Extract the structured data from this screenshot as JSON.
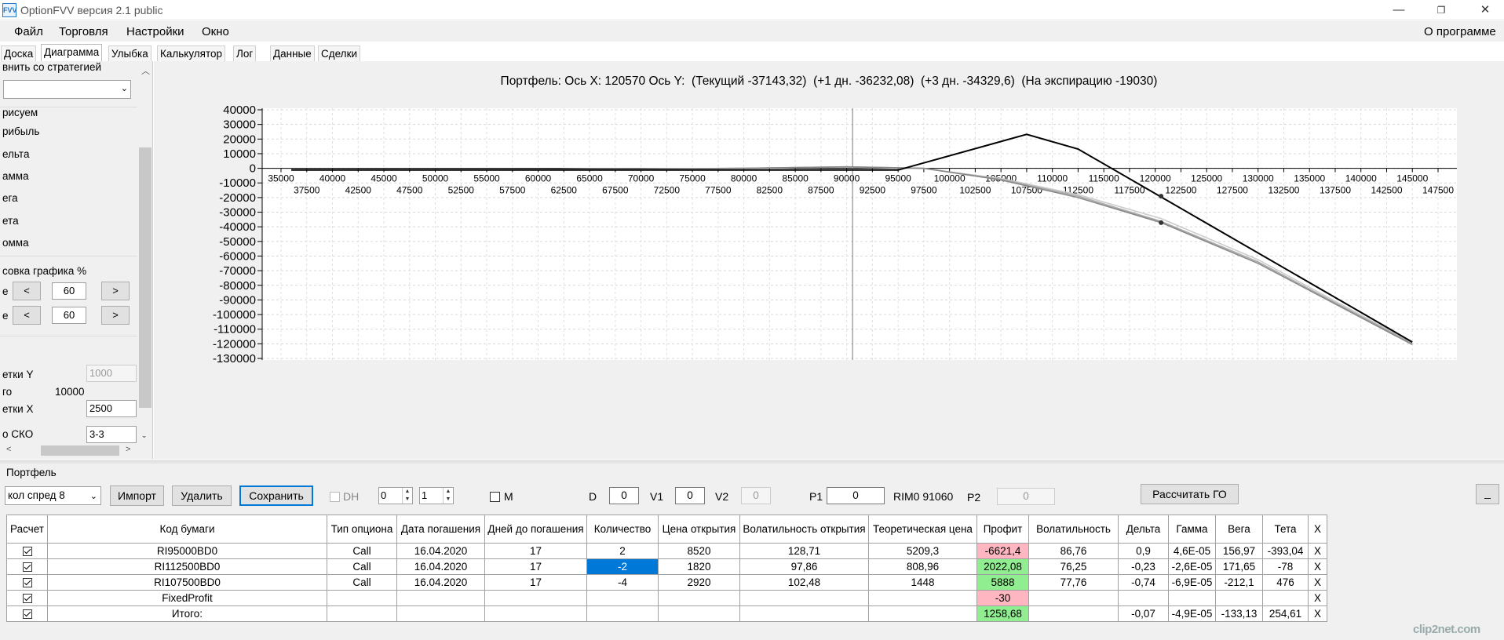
{
  "window": {
    "title": "OptionFVV версия 2.1 public",
    "icon_text": "FVV",
    "minimize": "—",
    "restore": "❐",
    "close": "✕"
  },
  "menu": {
    "file": "Файл",
    "trading": "Торговля",
    "settings": "Настройки",
    "window": "Окно",
    "about": "О программе"
  },
  "tabs": [
    "Доска",
    "Диаграмма",
    "Улыбка",
    "Калькулятор",
    "Лог",
    "Данные",
    "Сделки"
  ],
  "left_panel": {
    "compare_label": "внить со стратегией",
    "draw_label": "рисуем",
    "items": [
      "рибыль",
      "ельта",
      "амма",
      "ега",
      "ета",
      "омма"
    ],
    "scale_label": "совка графика %",
    "row1_prefix": "е",
    "row2_prefix": "е",
    "left_btn": "<",
    "right_btn": ">",
    "scale1_value": "60",
    "scale2_value": "60",
    "grid_y_label": "етки Y",
    "grid_y_value": "1000",
    "total_label": "го",
    "total_value": "10000",
    "grid_x_label": "етки X",
    "grid_x_value": "2500",
    "sko_label": "о СКО",
    "sko_value": "3-3"
  },
  "chart_data": {
    "type": "line",
    "title": "Портфель: Ось X: 120570 Ось Y:  (Текущий -37143,32)  (+1 дн. -36232,08)  (+3 дн. -34329,6)  (На экспирацию -19030)",
    "xlim": [
      35000,
      147500
    ],
    "ylim": [
      -130000,
      40000
    ],
    "y_ticks": [
      40000,
      30000,
      20000,
      10000,
      0,
      -10000,
      -20000,
      -30000,
      -40000,
      -50000,
      -60000,
      -70000,
      -80000,
      -90000,
      -100000,
      -110000,
      -120000,
      -130000
    ],
    "x_ticks_upper": [
      35000,
      40000,
      45000,
      50000,
      55000,
      60000,
      65000,
      70000,
      75000,
      80000,
      85000,
      90000,
      95000,
      100000,
      105000,
      110000,
      115000,
      120000,
      125000,
      130000,
      135000,
      140000,
      145000
    ],
    "x_ticks_lower": [
      37500,
      42500,
      47500,
      52500,
      57500,
      62500,
      67500,
      72500,
      77500,
      82500,
      87500,
      92500,
      97500,
      102500,
      107500,
      112500,
      117500,
      122500,
      127500,
      132500,
      137500,
      142500,
      147500
    ],
    "cursor_x": 90570,
    "grid": true,
    "series": [
      {
        "color": "#000000",
        "x": [
          36000,
          95000,
          107500,
          112500,
          145000
        ],
        "y": [
          -1200,
          -1200,
          23200,
          13200,
          -118800
        ]
      },
      {
        "color": "#888888",
        "x": [
          36000,
          60000,
          80000,
          90000,
          97500,
          105000,
          112500,
          120570,
          130000,
          145000
        ],
        "y": [
          -1000,
          -700,
          0,
          1000,
          0,
          -8000,
          -20000,
          -37143,
          -65000,
          -120500
        ]
      },
      {
        "color": "#aaaaaa",
        "x": [
          36000,
          60000,
          80000,
          90000,
          97500,
          105000,
          112500,
          120570,
          130000,
          145000
        ],
        "y": [
          -1000,
          -700,
          0,
          1000,
          0,
          -7500,
          -19000,
          -36232,
          -64000,
          -119800
        ]
      },
      {
        "color": "#cccccc",
        "x": [
          36000,
          60000,
          80000,
          90000,
          97500,
          105000,
          112500,
          120570,
          130000,
          145000
        ],
        "y": [
          -1000,
          -700,
          0,
          900,
          -200,
          -7000,
          -18000,
          -34330,
          -62500,
          -119200
        ]
      }
    ],
    "markers": [
      {
        "x": 120570,
        "y": -19030
      },
      {
        "x": 120570,
        "y": -37143
      }
    ]
  },
  "portfolio": {
    "label": "Портфель",
    "combo_value": "кол спред 8",
    "import": "Импорт",
    "delete": "Удалить",
    "save": "Сохранить",
    "dh": "DH",
    "spin1": "0",
    "spin2": "1",
    "m": "M",
    "d_label": "D",
    "d_value": "0",
    "v1_label": "V1",
    "v1_value": "0",
    "v2_label": "V2",
    "v2_value": "0",
    "p1_label": "P1",
    "p1_value": "0",
    "rim_label": "RIM0 91060",
    "p2_label": "P2",
    "p2_value": "0",
    "calc_go": "Рассчитать ГО",
    "min_btn": "_",
    "headers": [
      "Расчет",
      "Код бумаги",
      "Тип опциона",
      "Дата погашения",
      "Дней до погашения",
      "Количество",
      "Цена открытия",
      "Волатильность открытия",
      "Теоретическая цена",
      "Профит",
      "Волатильность",
      "Дельта",
      "Гамма",
      "Вега",
      "Тета",
      "X"
    ],
    "rows": [
      [
        "",
        "RI95000BD0",
        "Call",
        "16.04.2020",
        "17",
        "2",
        "8520",
        "128,71",
        "5209,3",
        "-6621,4",
        "86,76",
        "0,9",
        "4,6E-05",
        "156,97",
        "-393,04",
        "X"
      ],
      [
        "",
        "RI112500BD0",
        "Call",
        "16.04.2020",
        "17",
        "-2",
        "1820",
        "97,86",
        "808,96",
        "2022,08",
        "76,25",
        "-0,23",
        "-2,6E-05",
        "171,65",
        "-78",
        "X"
      ],
      [
        "",
        "RI107500BD0",
        "Call",
        "16.04.2020",
        "17",
        "-4",
        "2920",
        "102,48",
        "1448",
        "5888",
        "77,76",
        "-0,74",
        "-6,9E-05",
        "-212,1",
        "476",
        "X"
      ],
      [
        "",
        "FixedProfit",
        "",
        "",
        "",
        "",
        "",
        "",
        "",
        "-30",
        "",
        "",
        "",
        "",
        "",
        "X"
      ],
      [
        "",
        "Итого:",
        "",
        "",
        "",
        "",
        "",
        "",
        "",
        "1258,68",
        "",
        "-0,07",
        "-4,9E-05",
        "-133,13",
        "254,61",
        "X"
      ]
    ]
  },
  "watermark": "clip2net.com"
}
